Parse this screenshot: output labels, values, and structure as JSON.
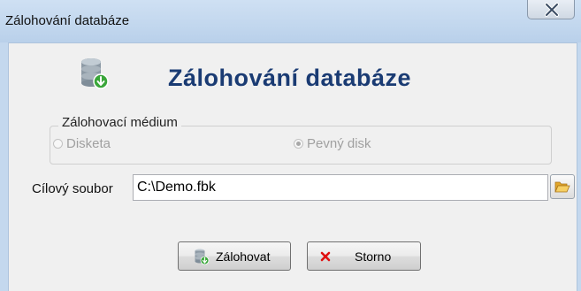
{
  "window": {
    "title": "Zálohování databáze",
    "close_glyph": "X"
  },
  "dialog": {
    "heading": "Zálohování databáze",
    "icon": "database-backup-icon"
  },
  "medium_group": {
    "legend": "Zálohovací médium",
    "options": [
      {
        "label": "Disketa",
        "checked": false,
        "enabled": false
      },
      {
        "label": "Pevný disk",
        "checked": true,
        "enabled": false
      }
    ]
  },
  "target_file": {
    "label": "Cílový soubor",
    "value": "C:\\Demo.fbk",
    "browse_icon": "folder-open-icon"
  },
  "buttons": {
    "backup_label": "Zálohovat",
    "cancel_label": "Storno"
  },
  "colors": {
    "heading": "#1a3b73",
    "titlebar": "#c2d7ee",
    "cancel_x": "#e01010"
  }
}
